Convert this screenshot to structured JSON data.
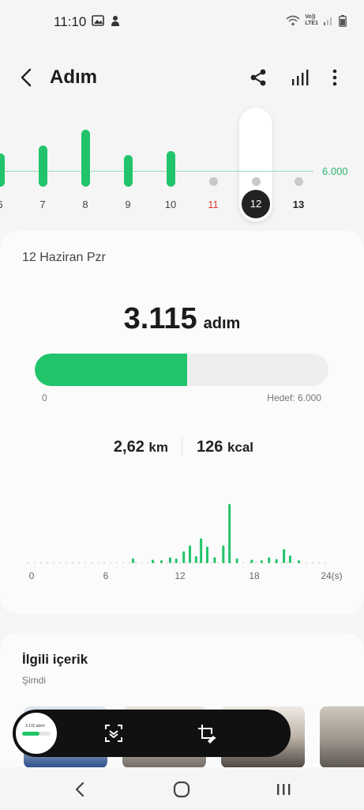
{
  "status": {
    "time": "11:10",
    "icons": [
      "gallery-icon",
      "notification-icon",
      "wifi-icon",
      "volte-lte-icon",
      "signal-icon",
      "battery-icon"
    ],
    "volte_label": "Vo))",
    "lte_label": "LTE1"
  },
  "appbar": {
    "title": "Adım",
    "icons": [
      "back-icon",
      "share-icon",
      "chart-icon",
      "more-icon"
    ]
  },
  "week": {
    "goal_label": "6.000",
    "goal": 6000,
    "selected_day": "12",
    "days": [
      {
        "label": "6",
        "steps": 4200,
        "color": "#444444"
      },
      {
        "label": "7",
        "steps": 5200,
        "color": "#444444"
      },
      {
        "label": "8",
        "steps": 7200,
        "color": "#444444"
      },
      {
        "label": "9",
        "steps": 4000,
        "color": "#444444"
      },
      {
        "label": "10",
        "steps": 4500,
        "color": "#444444"
      },
      {
        "label": "11",
        "steps": 0,
        "color": "#e03a3a"
      },
      {
        "label": "12",
        "steps": 0,
        "color": "#ffffff"
      },
      {
        "label": "13",
        "steps": 0,
        "color": "#222222"
      }
    ]
  },
  "summary": {
    "date": "12 Haziran Pzr",
    "steps": "3.115",
    "steps_unit": "adım",
    "progress_fraction": 0.519,
    "min_label": "0",
    "goal_label": "Hedef: 6.000",
    "distance_value": "2,62",
    "distance_unit": "km",
    "energy_value": "126",
    "energy_unit": "kcal"
  },
  "chart_data": {
    "type": "bar",
    "xlabels": [
      "0",
      "6",
      "12",
      "18",
      "24(s)"
    ],
    "xlim": [
      0,
      24
    ],
    "bars": [
      {
        "x": 8.2,
        "v": 0.08
      },
      {
        "x": 9.8,
        "v": 0.06
      },
      {
        "x": 10.5,
        "v": 0.05
      },
      {
        "x": 11.2,
        "v": 0.1
      },
      {
        "x": 11.7,
        "v": 0.08
      },
      {
        "x": 12.3,
        "v": 0.2
      },
      {
        "x": 12.8,
        "v": 0.3
      },
      {
        "x": 13.3,
        "v": 0.12
      },
      {
        "x": 13.7,
        "v": 0.42
      },
      {
        "x": 14.2,
        "v": 0.28
      },
      {
        "x": 14.8,
        "v": 0.1
      },
      {
        "x": 15.5,
        "v": 0.3
      },
      {
        "x": 16.0,
        "v": 1.0
      },
      {
        "x": 16.6,
        "v": 0.08
      },
      {
        "x": 17.8,
        "v": 0.06
      },
      {
        "x": 18.6,
        "v": 0.05
      },
      {
        "x": 19.2,
        "v": 0.1
      },
      {
        "x": 19.8,
        "v": 0.07
      },
      {
        "x": 20.4,
        "v": 0.24
      },
      {
        "x": 20.9,
        "v": 0.13
      },
      {
        "x": 21.6,
        "v": 0.05
      }
    ]
  },
  "related": {
    "title": "İlgili içerik",
    "subtitle": "Şimdi"
  },
  "toolbar": {
    "icons": [
      "scroll-capture-icon",
      "crop-edit-icon"
    ],
    "preview_text": "3.115 adım"
  },
  "navbar": {
    "icons": [
      "nav-back-icon",
      "nav-home-icon",
      "nav-recents-icon"
    ]
  },
  "colors": {
    "accent": "#21c46a",
    "goal_text": "#2bb56b",
    "weekend_red": "#e03a3a"
  }
}
